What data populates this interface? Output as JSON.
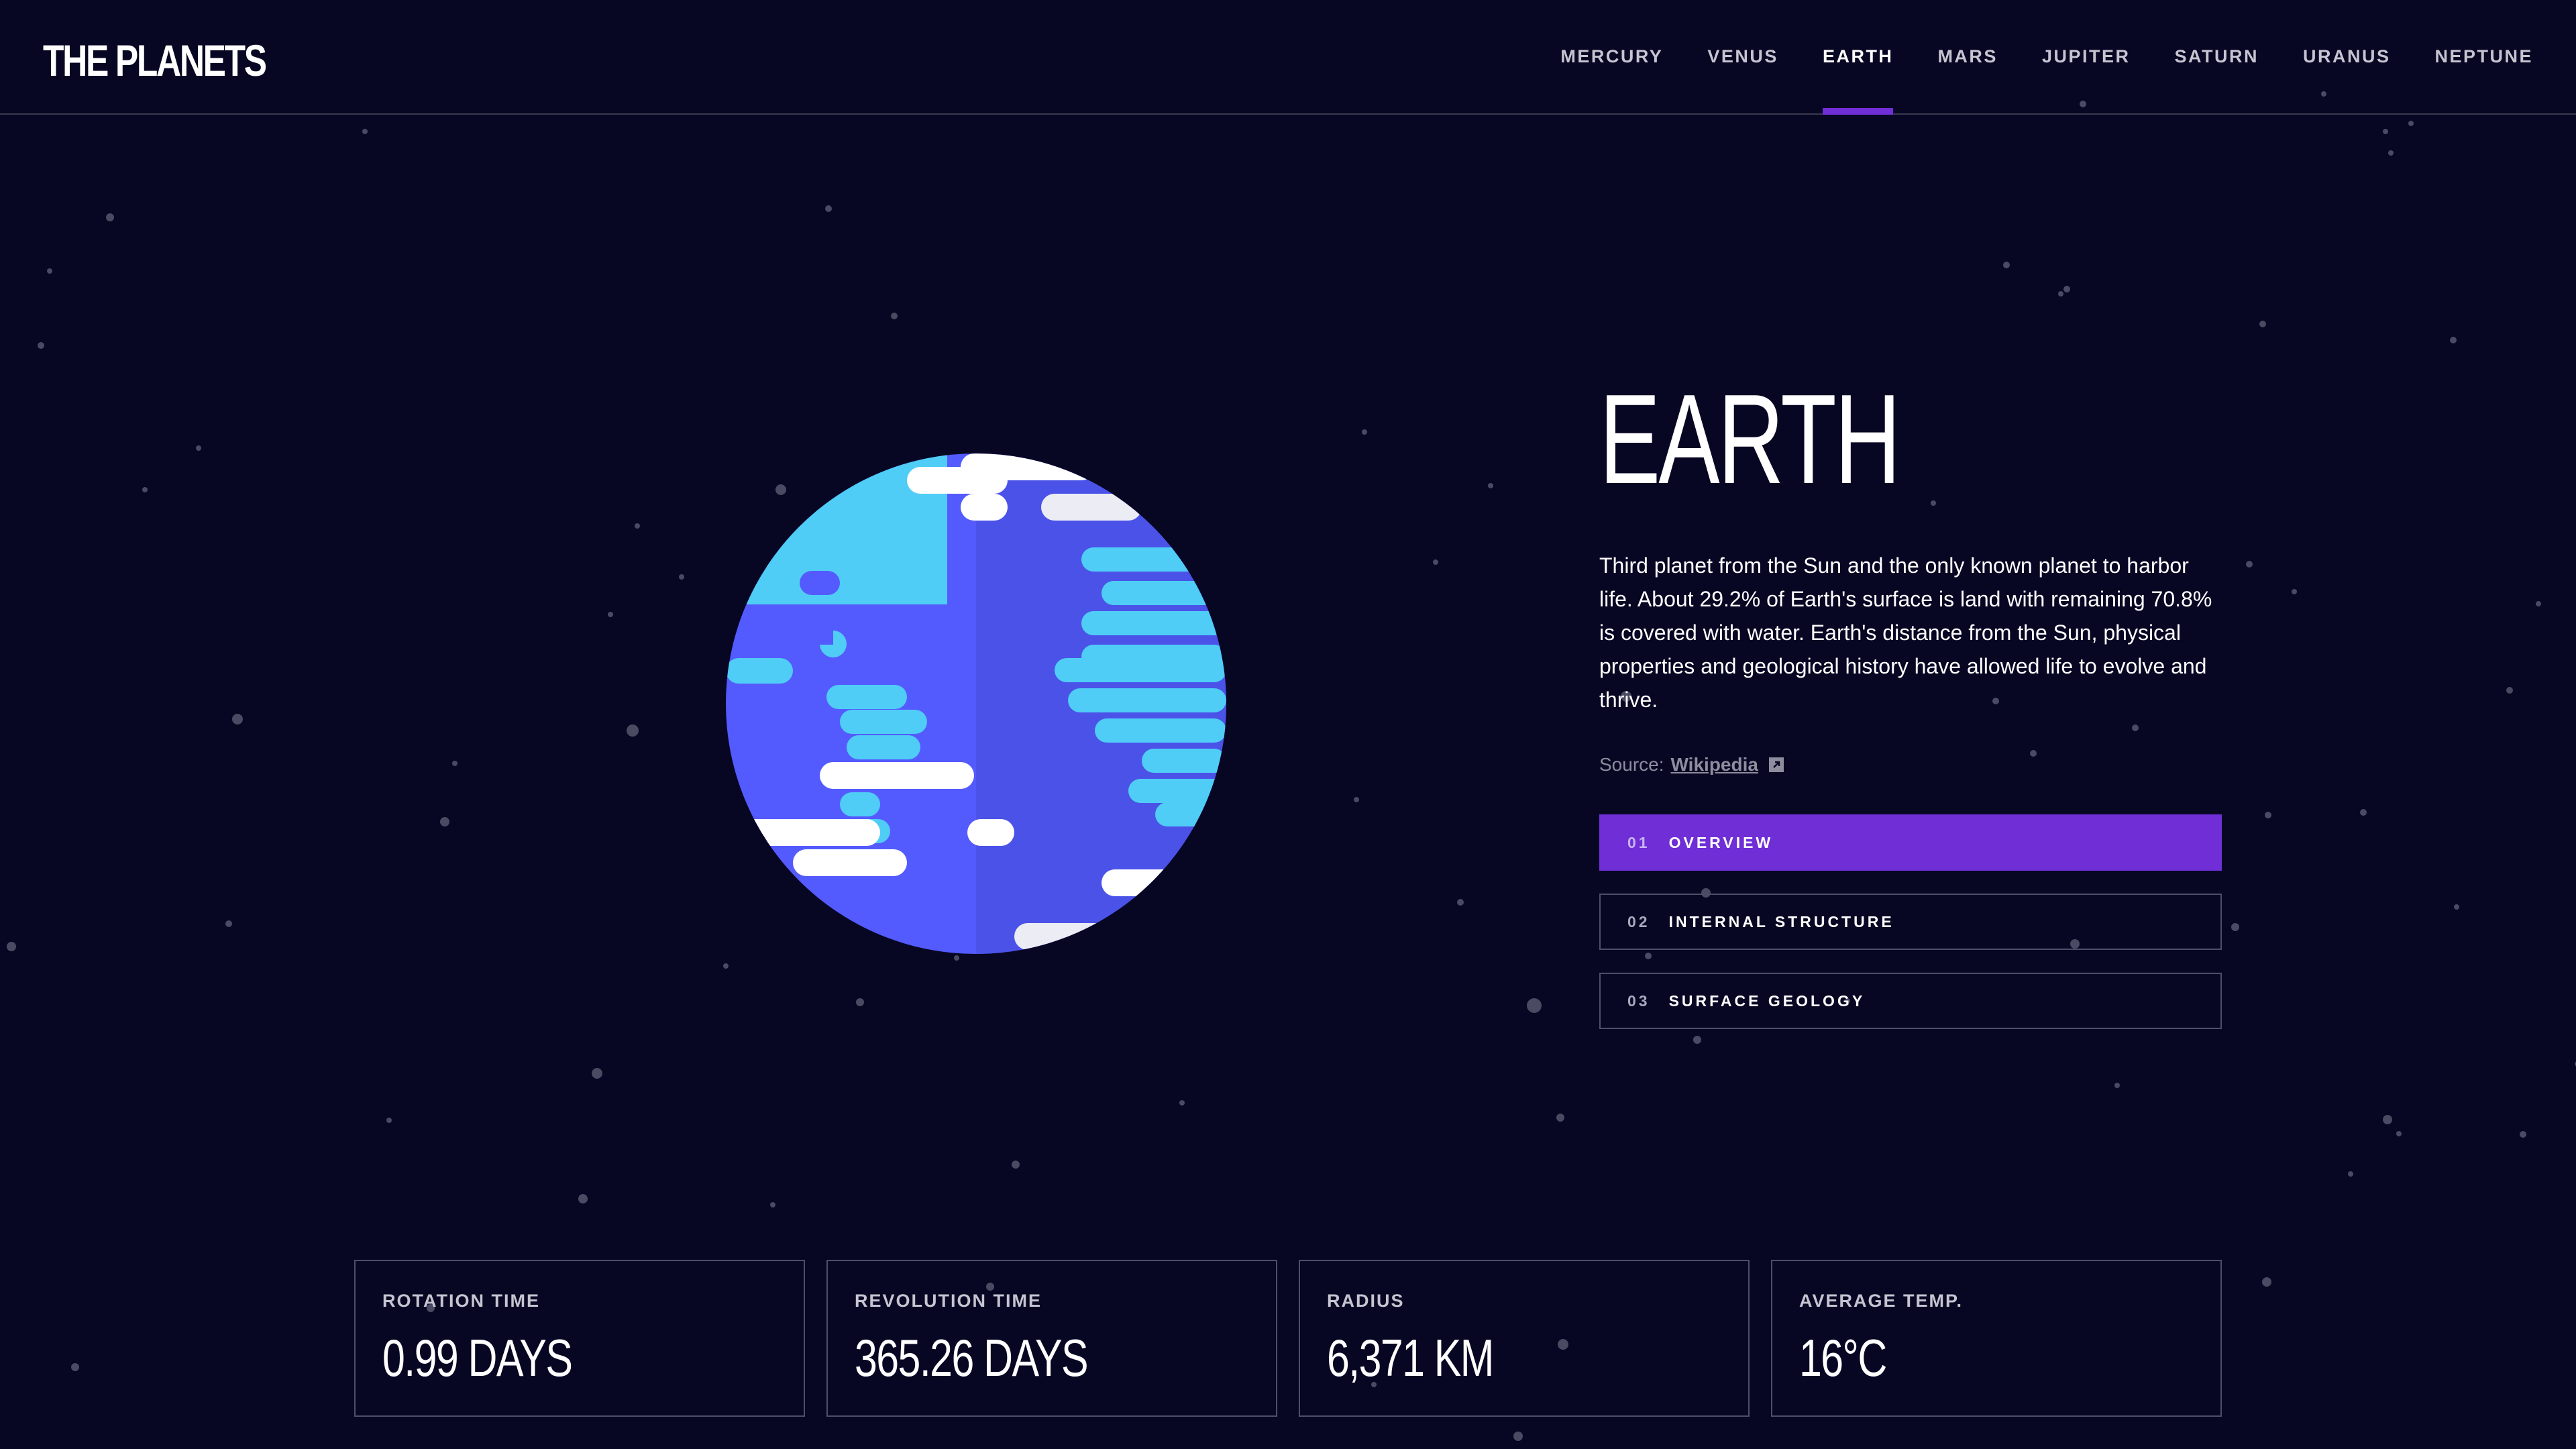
{
  "brand": {
    "logo": "THE PLANETS"
  },
  "nav": {
    "items": [
      "MERCURY",
      "VENUS",
      "EARTH",
      "MARS",
      "JUPITER",
      "SATURN",
      "URANUS",
      "NEPTUNE"
    ],
    "active": "EARTH"
  },
  "planet": {
    "name": "EARTH",
    "description": "Third planet from the Sun and the only known planet to harbor life. About 29.2% of Earth's surface is land with remaining 70.8% is covered with water. Earth's distance from the Sun, physical properties and geological history have allowed life to evolve and thrive.",
    "source_label": "Source:",
    "source_link": "Wikipedia",
    "icon": "earth-illustration"
  },
  "tabs": [
    {
      "num": "01",
      "label": "OVERVIEW",
      "active": true
    },
    {
      "num": "02",
      "label": "INTERNAL STRUCTURE",
      "active": false
    },
    {
      "num": "03",
      "label": "SURFACE GEOLOGY",
      "active": false
    }
  ],
  "stats": [
    {
      "label": "ROTATION TIME",
      "value": "0.99 DAYS"
    },
    {
      "label": "REVOLUTION TIME",
      "value": "365.26 DAYS"
    },
    {
      "label": "RADIUS",
      "value": "6,371 KM"
    },
    {
      "label": "AVERAGE TEMP.",
      "value": "16°C"
    }
  ],
  "colors": {
    "background": "#070724",
    "accent": "#6f2ed6",
    "border": "#4e4e66",
    "ocean": "#545bfe",
    "land": "#4fcdf6",
    "cloud": "#ffffff"
  }
}
